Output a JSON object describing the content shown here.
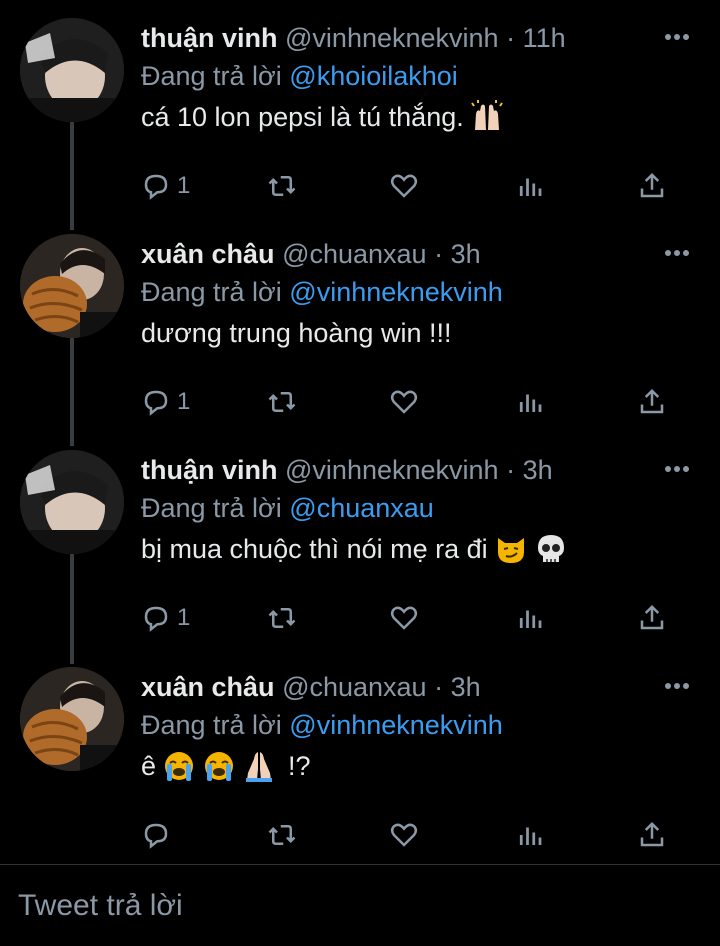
{
  "tweets": [
    {
      "name": "thuận vinh",
      "handle": "@vinhneknekvinh",
      "time": "· 11h",
      "reply_prefix": "Đang trả lời",
      "reply_to": "@khoioilakhoi",
      "text": "cá 10 lon pepsi là tú thắng.",
      "emojis": [
        "raising-hands"
      ],
      "reply_count": "1",
      "avatar": "avatar-thuan-vinh"
    },
    {
      "name": "xuân châu",
      "handle": "@chuanxau",
      "time": "· 3h",
      "reply_prefix": "Đang trả lời",
      "reply_to": "@vinhneknekvinh",
      "text": "dương trung hoàng win !!!",
      "emojis": [],
      "reply_count": "1",
      "avatar": "avatar-xuan-chau"
    },
    {
      "name": "thuận vinh",
      "handle": "@vinhneknekvinh",
      "time": "· 3h",
      "reply_prefix": "Đang trả lời",
      "reply_to": "@chuanxau",
      "text": "bị mua chuộc thì nói mẹ ra đi",
      "emojis": [
        "smirk-cat",
        "skull"
      ],
      "reply_count": "1",
      "avatar": "avatar-thuan-vinh"
    },
    {
      "name": "xuân châu",
      "handle": "@chuanxau",
      "time": "· 3h",
      "reply_prefix": "Đang trả lời",
      "reply_to": "@vinhneknekvinh",
      "text": "ê",
      "text_suffix": "!?",
      "emojis": [
        "loudly-crying-face",
        "loudly-crying-face",
        "folded-hands"
      ],
      "reply_count": "",
      "avatar": "avatar-xuan-chau"
    }
  ],
  "reply_bar": {
    "placeholder": "Tweet trả lời"
  },
  "colors": {
    "background": "#000000",
    "text": "#e7e9ea",
    "muted": "#8b98a5",
    "link": "#3b9cf0"
  }
}
